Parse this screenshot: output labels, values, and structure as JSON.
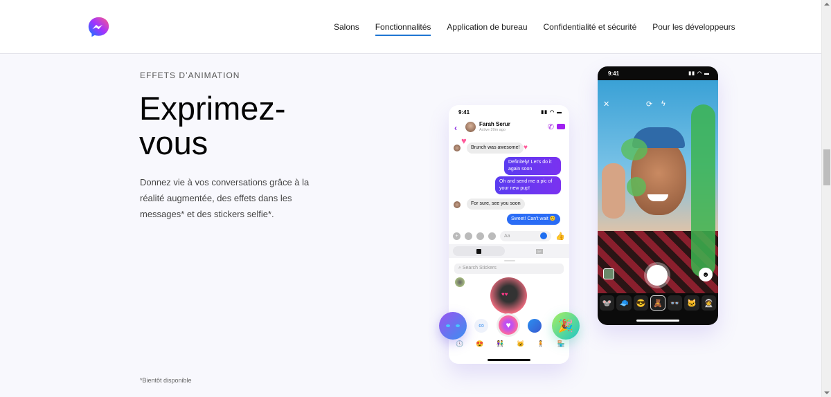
{
  "header": {
    "logo": "messenger-logo",
    "nav": [
      {
        "label": "Salons",
        "active": false
      },
      {
        "label": "Fonctionnalités",
        "active": true
      },
      {
        "label": "Application de bureau",
        "active": false
      },
      {
        "label": "Confidentialité et sécurité",
        "active": false
      },
      {
        "label": "Pour les développeurs",
        "active": false
      }
    ],
    "accent_color": "#1f76d3"
  },
  "hero": {
    "eyebrow": "EFFETS D’ANIMATION",
    "title": "Exprimez-vous",
    "description": "Donnez vie à vos conversations grâce à la réalité augmentée, des effets dans les messages* et des stickers selfie*.",
    "footnote": "*Bientôt disponible"
  },
  "phone_chat": {
    "time": "9:41",
    "contact_name": "Farah Serur",
    "contact_status": "Active 20m ago",
    "messages": [
      {
        "from": "them",
        "text": "Brunch was awesome!"
      },
      {
        "from": "me",
        "text": "Definitely! Let's do it again soon"
      },
      {
        "from": "me",
        "text": "Oh and send me a pic of your new pup!"
      },
      {
        "from": "them",
        "text": "For sure, see you soon"
      },
      {
        "from": "me",
        "text": "Sweet! Can't wait 😊"
      }
    ],
    "composer_placeholder": "Aa",
    "sticker_search_placeholder": "Search Stickers",
    "tray_tabs": [
      "stickers",
      "GIF"
    ]
  },
  "phone_camera": {
    "time": "9:41",
    "effects_count": 7,
    "selected_effect_index": 3
  }
}
